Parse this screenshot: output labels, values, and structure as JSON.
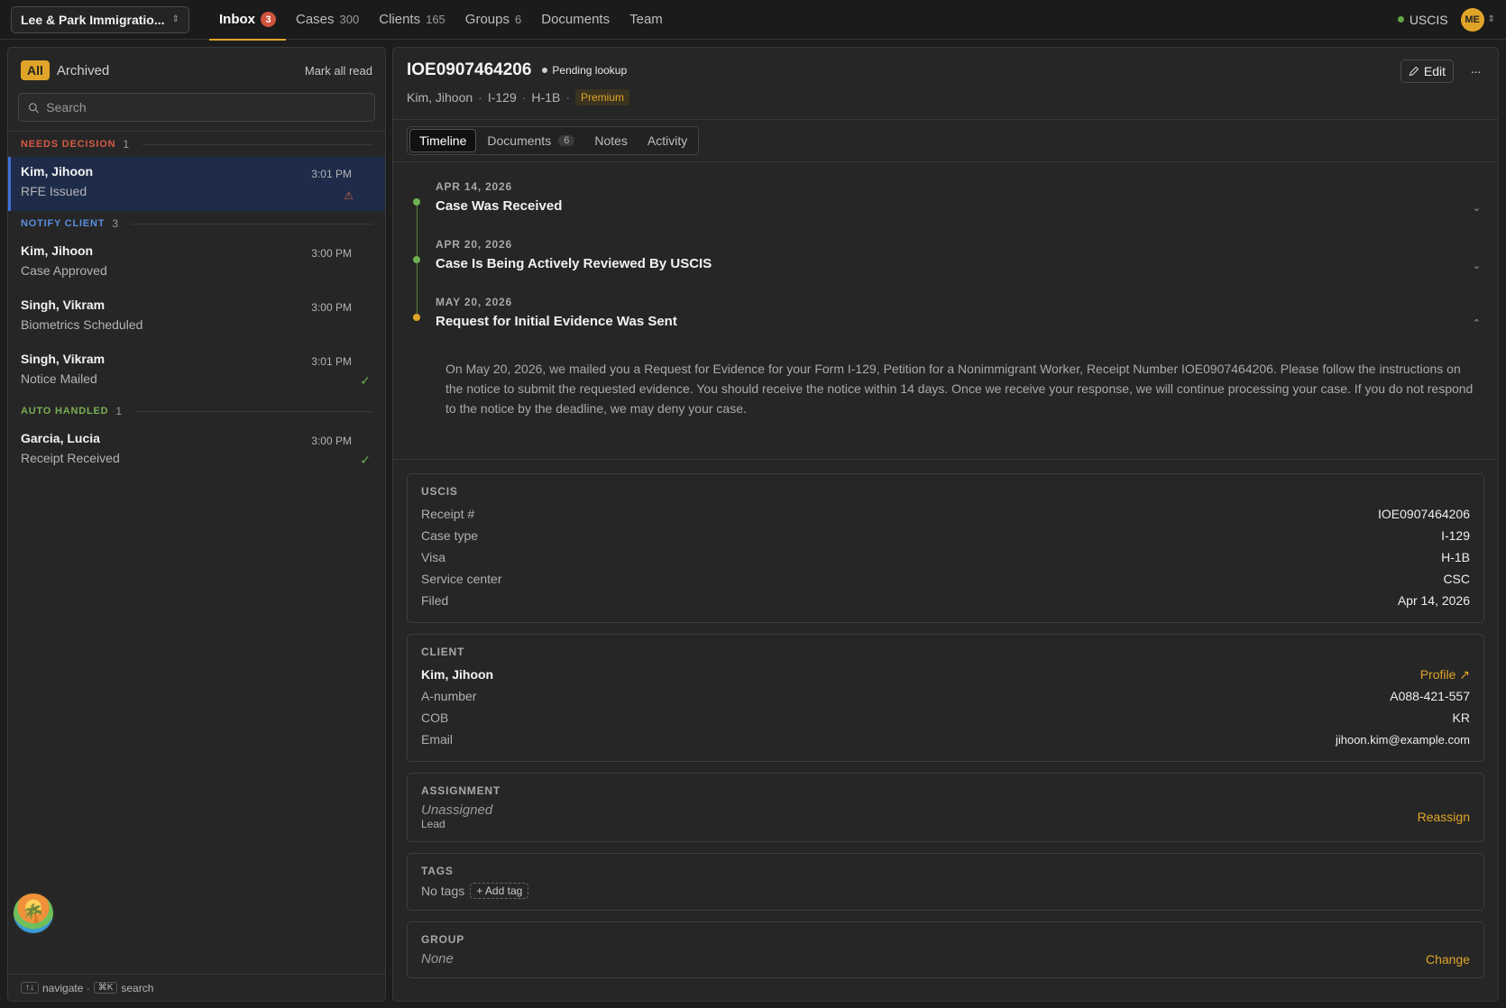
{
  "topbar": {
    "org": "Lee & Park Immigratio...",
    "nav": [
      {
        "label": "Inbox",
        "count": "3",
        "active": true
      },
      {
        "label": "Cases",
        "count": "300"
      },
      {
        "label": "Clients",
        "count": "165"
      },
      {
        "label": "Groups",
        "count": "6"
      },
      {
        "label": "Documents",
        "count": ""
      },
      {
        "label": "Team",
        "count": ""
      }
    ],
    "status_label": "USCIS",
    "avatar": "ME"
  },
  "inbox": {
    "filter_all": "All",
    "filter_archived": "Archived",
    "mark_all_read": "Mark all read",
    "search_placeholder": "Search",
    "groups": [
      {
        "title": "NEEDS DECISION",
        "count": "1",
        "items": [
          {
            "name": "Kim, Jihoon",
            "sub": "RFE Issued",
            "time": "3:01 PM"
          }
        ]
      },
      {
        "title": "NOTIFY CLIENT",
        "count": "3",
        "items": [
          {
            "name": "Kim, Jihoon",
            "sub": "Case Approved",
            "time": "3:00 PM"
          },
          {
            "name": "Singh, Vikram",
            "sub": "Biometrics Scheduled",
            "time": "3:00 PM"
          },
          {
            "name": "Singh, Vikram",
            "sub": "Notice Mailed",
            "time": "3:01 PM"
          }
        ]
      },
      {
        "title": "AUTO HANDLED",
        "count": "1",
        "items": [
          {
            "name": "Garcia, Lucia",
            "sub": "Receipt Received",
            "time": "3:00 PM"
          }
        ]
      }
    ],
    "footer_navigate": "navigate ·",
    "footer_search": "search",
    "kbd_nav": "↑↓",
    "kbd_search": "⌘K"
  },
  "case": {
    "receipt": "IOE0907464206",
    "status": "Pending lookup",
    "client": "Kim, Jihoon",
    "form": "I-129",
    "visa": "H-1B",
    "tier": "Premium",
    "edit_label": "Edit",
    "more_label": "···",
    "tabs": [
      {
        "label": "Timeline"
      },
      {
        "label": "Documents",
        "count": "6"
      },
      {
        "label": "Notes"
      },
      {
        "label": "Activity"
      }
    ],
    "timeline": [
      {
        "date": "APR 14, 2026",
        "title": "Case Was Received"
      },
      {
        "date": "APR 20, 2026",
        "title": "Case Is Being Actively Reviewed By USCIS"
      },
      {
        "date": "MAY 20, 2026",
        "title": "Request for Initial Evidence Was Sent",
        "body": "On May 20, 2026, we mailed you a Request for Evidence for your Form I-129, Petition for a Nonimmigrant Worker, Receipt Number IOE0907464206. Please follow the instructions on the notice to submit the requested evidence. You should receive the notice within 14 days. Once we receive your response, we will continue processing your case. If you do not respond to the notice by the deadline, we may deny your case."
      }
    ],
    "uscis": {
      "title": "USCIS",
      "rows": [
        {
          "k": "Receipt #",
          "v": "IOE0907464206"
        },
        {
          "k": "Case type",
          "v": "I-129"
        },
        {
          "k": "Visa",
          "v": "H-1B"
        },
        {
          "k": "Service center",
          "v": "CSC"
        },
        {
          "k": "Filed",
          "v": "Apr 14, 2026"
        }
      ]
    },
    "client_card": {
      "title": "CLIENT",
      "name": "Kim, Jihoon",
      "profile_label": "Profile",
      "rows": [
        {
          "k": "A-number",
          "v": "A088-421-557"
        },
        {
          "k": "COB",
          "v": "KR"
        },
        {
          "k": "Email",
          "v": "jihoon.kim@example.com"
        }
      ]
    },
    "assignment": {
      "title": "ASSIGNMENT",
      "value": "Unassigned",
      "role": "Lead",
      "action": "Reassign"
    },
    "tags": {
      "title": "TAGS",
      "empty": "No tags",
      "add": "+ Add tag"
    },
    "group": {
      "title": "GROUP",
      "value": "None",
      "action": "Change"
    }
  },
  "colors": {
    "accent": "#e0a528",
    "danger": "#d35a44",
    "info": "#5b8ee0",
    "success": "#6fb152",
    "selected_row": "#1e2c4a"
  }
}
